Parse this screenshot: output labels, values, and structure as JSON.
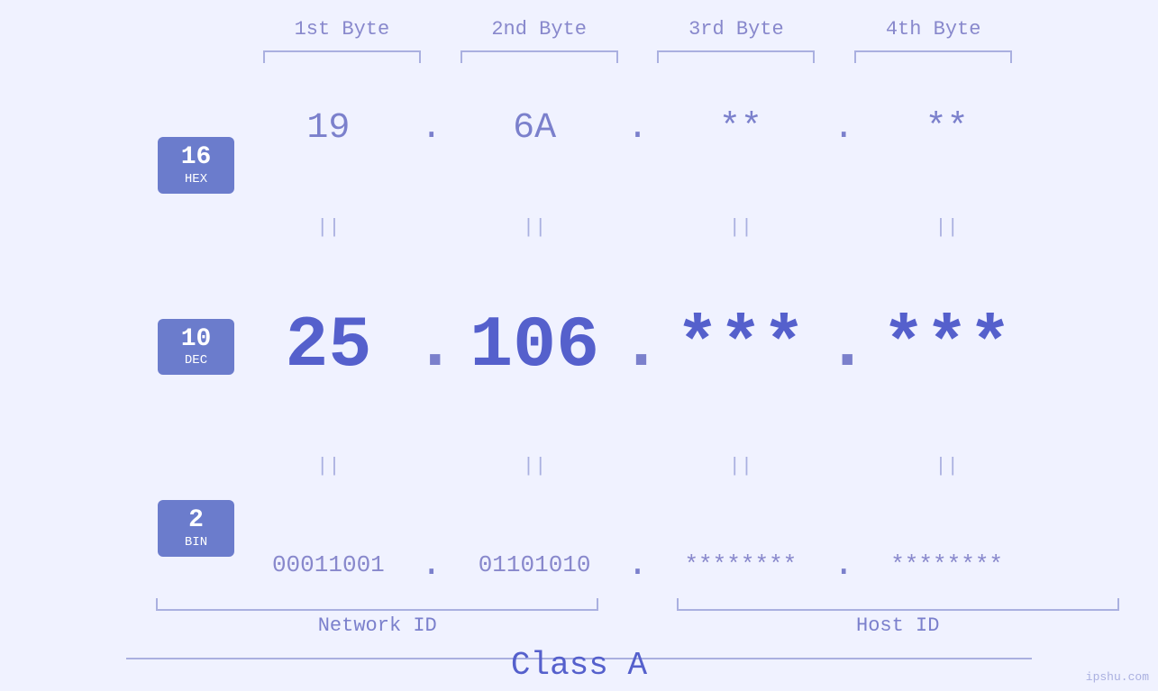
{
  "header": {
    "bytes": [
      "1st Byte",
      "2nd Byte",
      "3rd Byte",
      "4th Byte"
    ]
  },
  "bases": [
    {
      "num": "16",
      "label": "HEX"
    },
    {
      "num": "10",
      "label": "DEC"
    },
    {
      "num": "2",
      "label": "BIN"
    }
  ],
  "hex_row": {
    "values": [
      "19",
      "6A",
      "**",
      "**"
    ],
    "dots": [
      ".",
      ".",
      "."
    ]
  },
  "dec_row": {
    "values": [
      "25",
      "106",
      "***",
      "***"
    ],
    "dots": [
      ".",
      ".",
      "."
    ]
  },
  "bin_row": {
    "values": [
      "00011001",
      "01101010",
      "********",
      "********"
    ],
    "dots": [
      ".",
      ".",
      "."
    ]
  },
  "separator": "||",
  "labels": {
    "network_id": "Network ID",
    "host_id": "Host ID",
    "class": "Class A"
  },
  "watermark": "ipshu.com"
}
